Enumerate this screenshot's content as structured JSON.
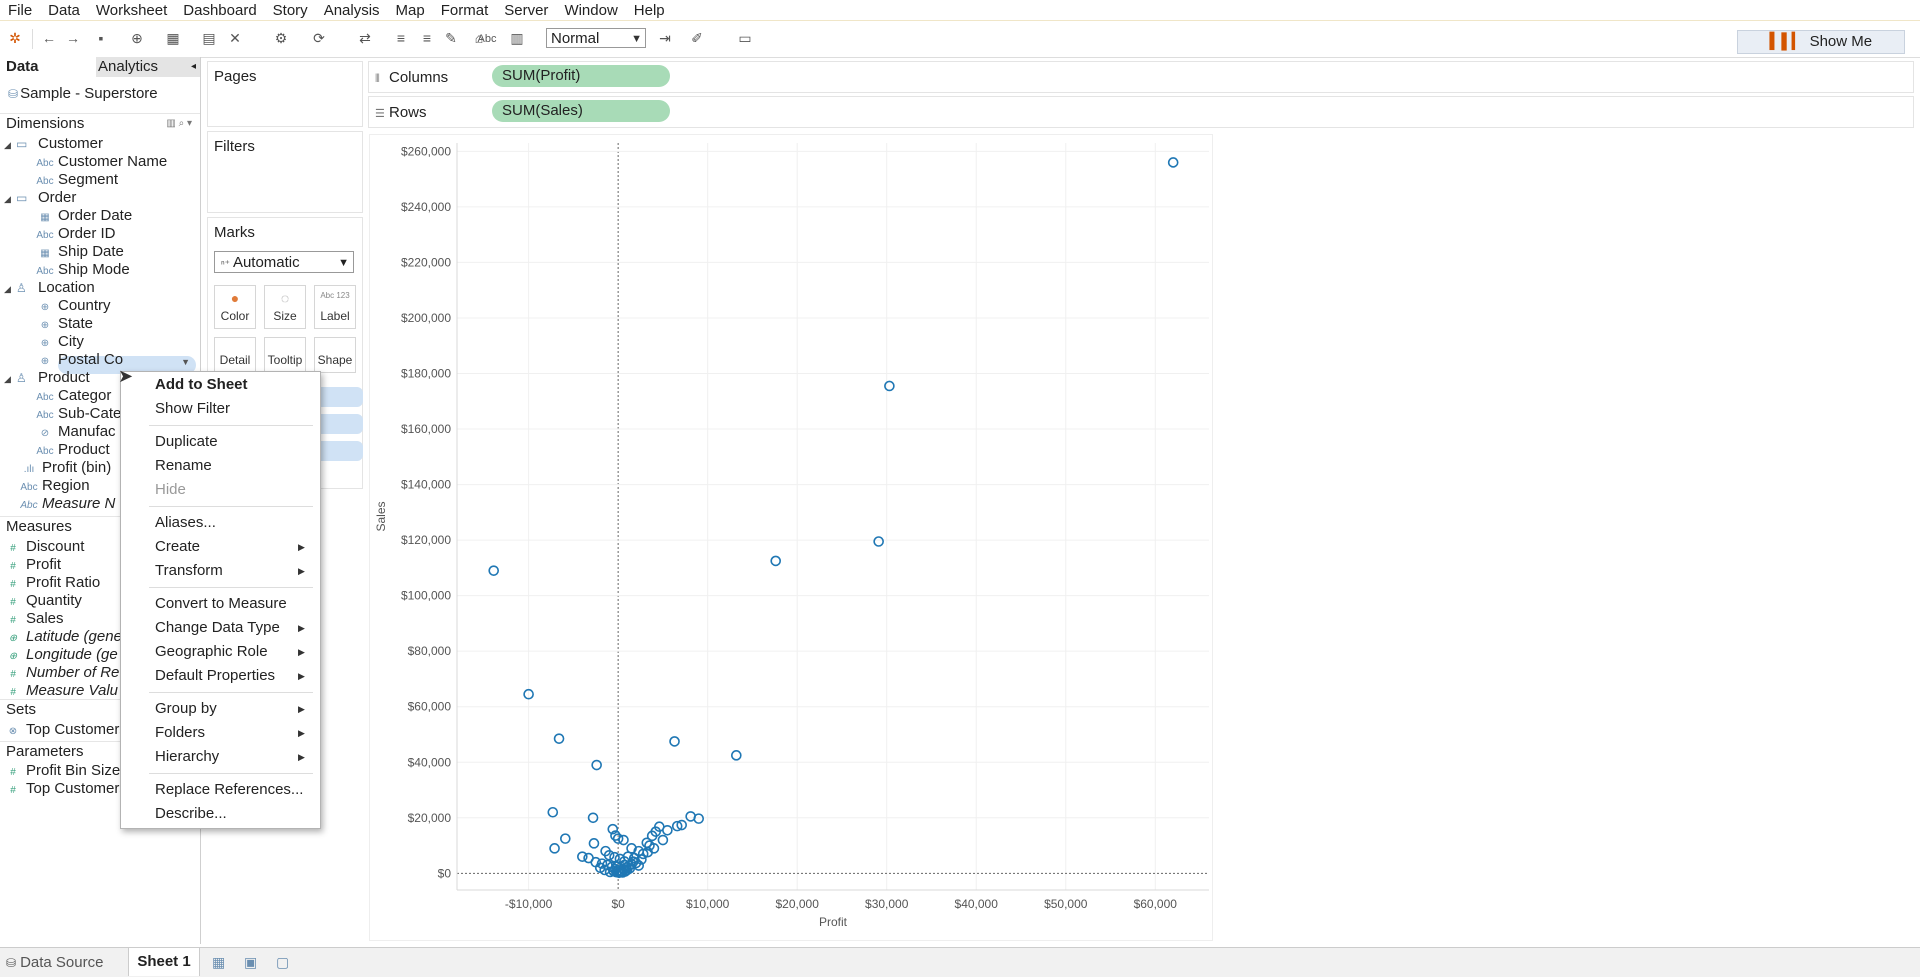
{
  "menubar": [
    "File",
    "Data",
    "Worksheet",
    "Dashboard",
    "Story",
    "Analysis",
    "Map",
    "Format",
    "Server",
    "Window",
    "Help"
  ],
  "toolbar": {
    "fit": "Normal",
    "text_tool": "Abc",
    "show_me": "Show Me"
  },
  "data_pane": {
    "tab_data": "Data",
    "tab_analytics": "Analytics",
    "datasource": "Sample - Superstore",
    "dimensions_header": "Dimensions",
    "measures_header": "Measures",
    "sets_header": "Sets",
    "parameters_header": "Parameters",
    "dimensions": {
      "customer": "Customer",
      "customer_name": "Customer Name",
      "segment": "Segment",
      "order": "Order",
      "order_date": "Order Date",
      "order_id": "Order ID",
      "ship_date": "Ship Date",
      "ship_mode": "Ship Mode",
      "location": "Location",
      "country": "Country",
      "state": "State",
      "city": "City",
      "postal": "Postal Co",
      "product": "Product",
      "category": "Categor",
      "subcat": "Sub-Cate",
      "manufacturer": "Manufac",
      "productname": "Product",
      "profit_bin": "Profit (bin)",
      "region": "Region",
      "measure_names": "Measure N"
    },
    "measures": {
      "discount": "Discount",
      "profit": "Profit",
      "profit_ratio": "Profit Ratio",
      "quantity": "Quantity",
      "sales": "Sales",
      "latitude": "Latitude (gene",
      "longitude": "Longitude (ge",
      "records": "Number of Re",
      "measure_values": "Measure Valu"
    },
    "sets": {
      "top_customers": "Top Customers by Profit"
    },
    "parameters": {
      "profit_bin_size": "Profit Bin Size",
      "top_customers": "Top Customers"
    }
  },
  "cards": {
    "pages": "Pages",
    "filters": "Filters",
    "marks": "Marks",
    "marks_type": "Automatic",
    "color": "Color",
    "size": "Size",
    "label": "Label",
    "detail": "Detail",
    "tooltip": "Tooltip",
    "shape": "Shape",
    "label_glyph": "Abc 123"
  },
  "shelves": {
    "columns_label": "Columns",
    "columns_pill": "SUM(Profit)",
    "rows_label": "Rows",
    "rows_pill": "SUM(Sales)"
  },
  "context_menu": [
    {
      "label": "Add to Sheet",
      "bold": true
    },
    {
      "label": "Show Filter"
    },
    {
      "label": "Duplicate"
    },
    {
      "label": "Rename"
    },
    {
      "label": "Hide",
      "disabled": true
    },
    {
      "label": "Aliases..."
    },
    {
      "label": "Create",
      "submenu": true
    },
    {
      "label": "Transform",
      "submenu": true
    },
    {
      "label": "Convert to Measure"
    },
    {
      "label": "Change Data Type",
      "submenu": true
    },
    {
      "label": "Geographic Role",
      "submenu": true
    },
    {
      "label": "Default Properties",
      "submenu": true
    },
    {
      "label": "Group by",
      "submenu": true
    },
    {
      "label": "Folders",
      "submenu": true
    },
    {
      "label": "Hierarchy",
      "submenu": true
    },
    {
      "label": "Replace References..."
    },
    {
      "label": "Describe..."
    }
  ],
  "bottom": {
    "datasource_tab": "Data Source",
    "sheet_tab": "Sheet 1"
  },
  "chart_data": {
    "type": "scatter",
    "xlabel": "Profit",
    "ylabel": "Sales",
    "xlim": [
      -18000,
      66000
    ],
    "ylim": [
      -6000,
      263000
    ],
    "x_ticks": [
      -10000,
      0,
      10000,
      20000,
      30000,
      40000,
      50000,
      60000
    ],
    "x_tick_labels": [
      "-$10,000",
      "$0",
      "$10,000",
      "$20,000",
      "$30,000",
      "$40,000",
      "$50,000",
      "$60,000"
    ],
    "y_ticks": [
      0,
      20000,
      40000,
      60000,
      80000,
      100000,
      120000,
      140000,
      160000,
      180000,
      200000,
      220000,
      240000,
      260000
    ],
    "y_tick_labels": [
      "$0",
      "$20,000",
      "$40,000",
      "$60,000",
      "$80,000",
      "$100,000",
      "$120,000",
      "$140,000",
      "$160,000",
      "$180,000",
      "$200,000",
      "$220,000",
      "$240,000",
      "$260,000"
    ],
    "grid": true,
    "marker_color": "#1f77b4",
    "points": [
      [
        62000,
        256000
      ],
      [
        30300,
        175500
      ],
      [
        29100,
        119500
      ],
      [
        17600,
        112500
      ],
      [
        -13900,
        109000
      ],
      [
        -10000,
        64500
      ],
      [
        -6600,
        48500
      ],
      [
        6300,
        47500
      ],
      [
        -2400,
        39000
      ],
      [
        13200,
        42500
      ],
      [
        -7300,
        22000
      ],
      [
        -2800,
        20000
      ],
      [
        8100,
        20500
      ],
      [
        9000,
        19700
      ],
      [
        -5900,
        12500
      ],
      [
        -7100,
        9000
      ],
      [
        -3300,
        5500
      ],
      [
        -2700,
        10800
      ],
      [
        -600,
        15900
      ],
      [
        -300,
        13600
      ],
      [
        0,
        12500
      ],
      [
        600,
        12000
      ],
      [
        1500,
        9000
      ],
      [
        2300,
        8000
      ],
      [
        3200,
        11000
      ],
      [
        3800,
        13500
      ],
      [
        4200,
        15000
      ],
      [
        4600,
        16800
      ],
      [
        5500,
        15500
      ],
      [
        6600,
        17000
      ],
      [
        7100,
        17400
      ],
      [
        -1400,
        8000
      ],
      [
        -1000,
        6500
      ],
      [
        -400,
        5800
      ],
      [
        200,
        5200
      ],
      [
        700,
        4300
      ],
      [
        1100,
        6000
      ],
      [
        1800,
        5500
      ],
      [
        2600,
        5000
      ],
      [
        2800,
        7000
      ],
      [
        3300,
        7600
      ],
      [
        -1800,
        3500
      ],
      [
        -1200,
        3000
      ],
      [
        -700,
        2300
      ],
      [
        -300,
        1500
      ],
      [
        0,
        1000
      ],
      [
        200,
        400
      ],
      [
        400,
        800
      ],
      [
        600,
        1500
      ],
      [
        900,
        2100
      ],
      [
        1200,
        2700
      ],
      [
        1500,
        3300
      ],
      [
        2000,
        3700
      ],
      [
        -900,
        500
      ],
      [
        -500,
        800
      ],
      [
        -200,
        400
      ],
      [
        100,
        200
      ],
      [
        300,
        600
      ],
      [
        500,
        300
      ],
      [
        800,
        700
      ],
      [
        1000,
        1200
      ],
      [
        1300,
        1800
      ],
      [
        -100,
        2500
      ],
      [
        700,
        3000
      ],
      [
        1700,
        4200
      ],
      [
        2300,
        2800
      ],
      [
        -1500,
        1200
      ],
      [
        -2000,
        2000
      ],
      [
        -2500,
        4000
      ],
      [
        -4000,
        6000
      ],
      [
        4000,
        9000
      ],
      [
        5000,
        12000
      ],
      [
        3500,
        10000
      ]
    ]
  }
}
